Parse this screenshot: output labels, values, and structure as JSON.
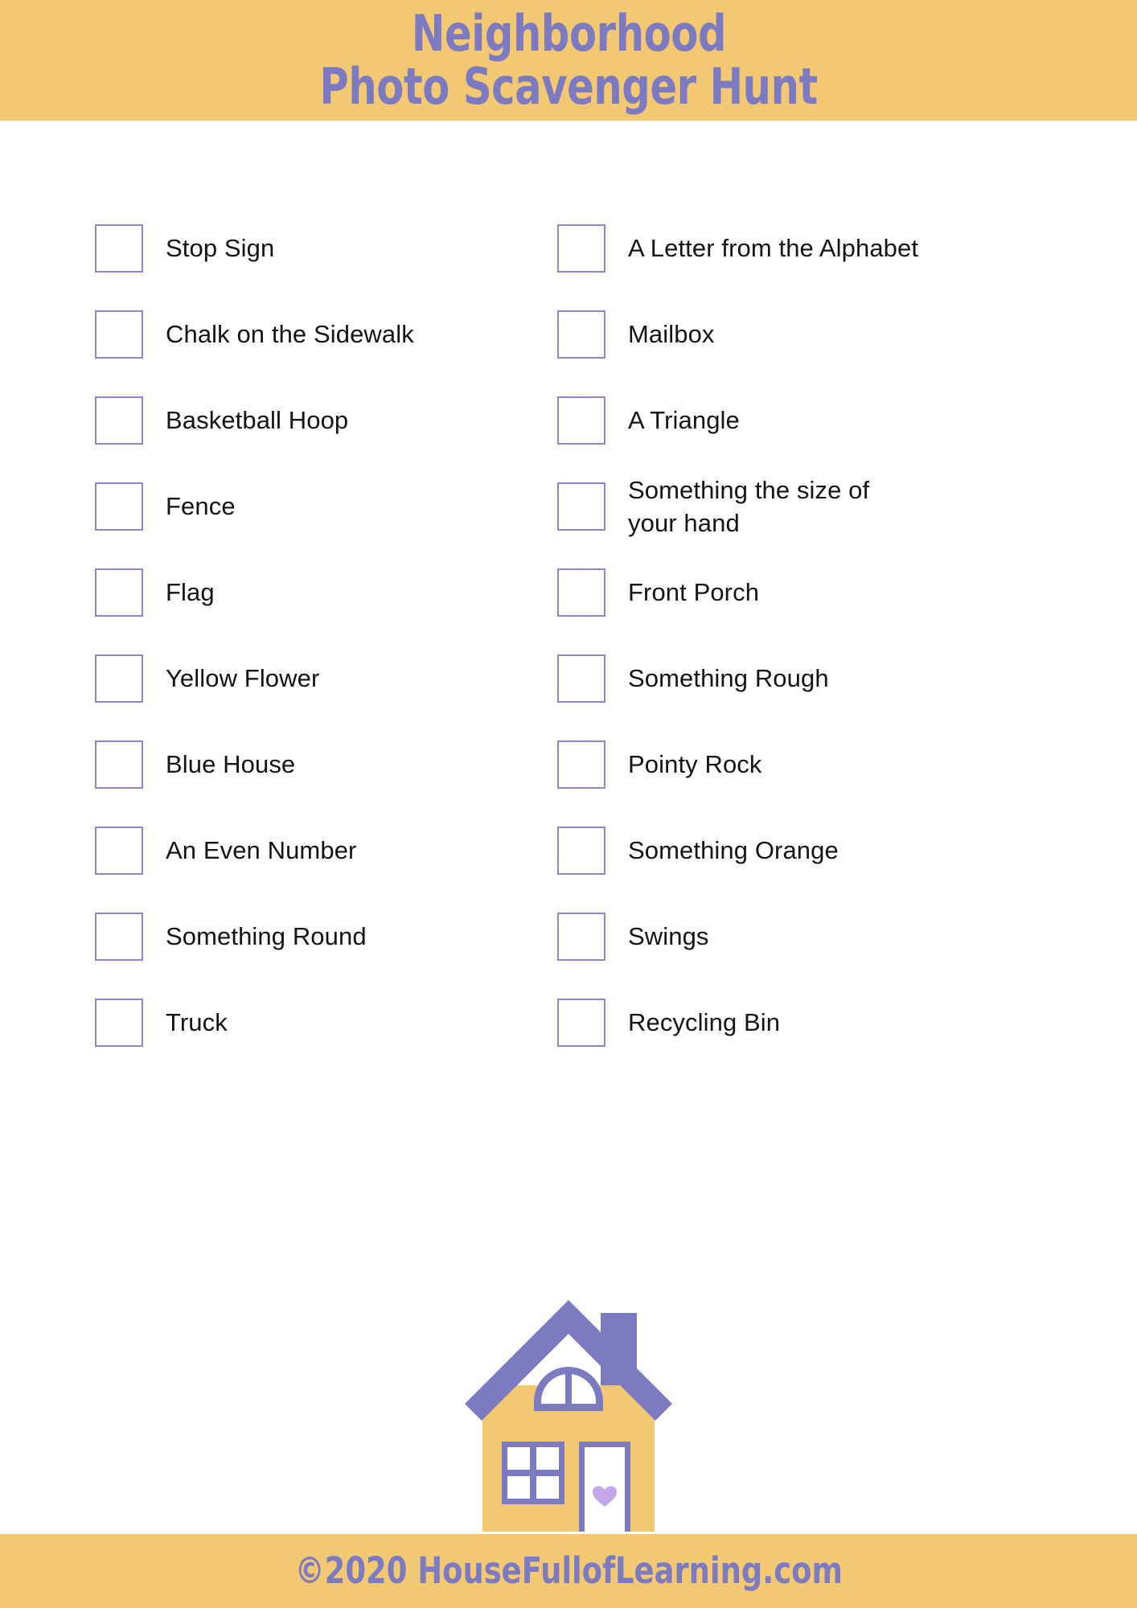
{
  "header": {
    "title_line1": "Neighborhood",
    "title_line2": "Photo Scavenger Hunt",
    "background_color": "#f2c872",
    "text_color": "#7c7ac0"
  },
  "checklist": {
    "checkbox_border_color": "#8a87c6",
    "label_color": "#141414",
    "left_column": [
      {
        "label": "Stop Sign"
      },
      {
        "label": "Chalk on the Sidewalk"
      },
      {
        "label": "Basketball Hoop"
      },
      {
        "label": "Fence"
      },
      {
        "label": "Flag"
      },
      {
        "label": "Yellow Flower"
      },
      {
        "label": "Blue House"
      },
      {
        "label": "An Even Number"
      },
      {
        "label": "Something Round"
      },
      {
        "label": "Truck"
      }
    ],
    "right_column": [
      {
        "label": "A Letter from the Alphabet"
      },
      {
        "label": "Mailbox"
      },
      {
        "label": "A Triangle"
      },
      {
        "label": "Something the size of\nyour hand"
      },
      {
        "label": "Front Porch"
      },
      {
        "label": "Something Rough"
      },
      {
        "label": "Pointy Rock"
      },
      {
        "label": "Something Orange"
      },
      {
        "label": "Swings"
      },
      {
        "label": "Recycling Bin"
      }
    ]
  },
  "illustration": {
    "name": "house-illustration",
    "body_color": "#f2c872",
    "roof_color": "#7c7ac0",
    "trim_color": "#7c7ac0",
    "door_color": "#ffffff",
    "heart_color": "#c2a8e8"
  },
  "footer": {
    "copyright": "©2020 HouseFullofLearning.com",
    "background_color": "#f2c872",
    "text_color": "#7c7ac0"
  }
}
